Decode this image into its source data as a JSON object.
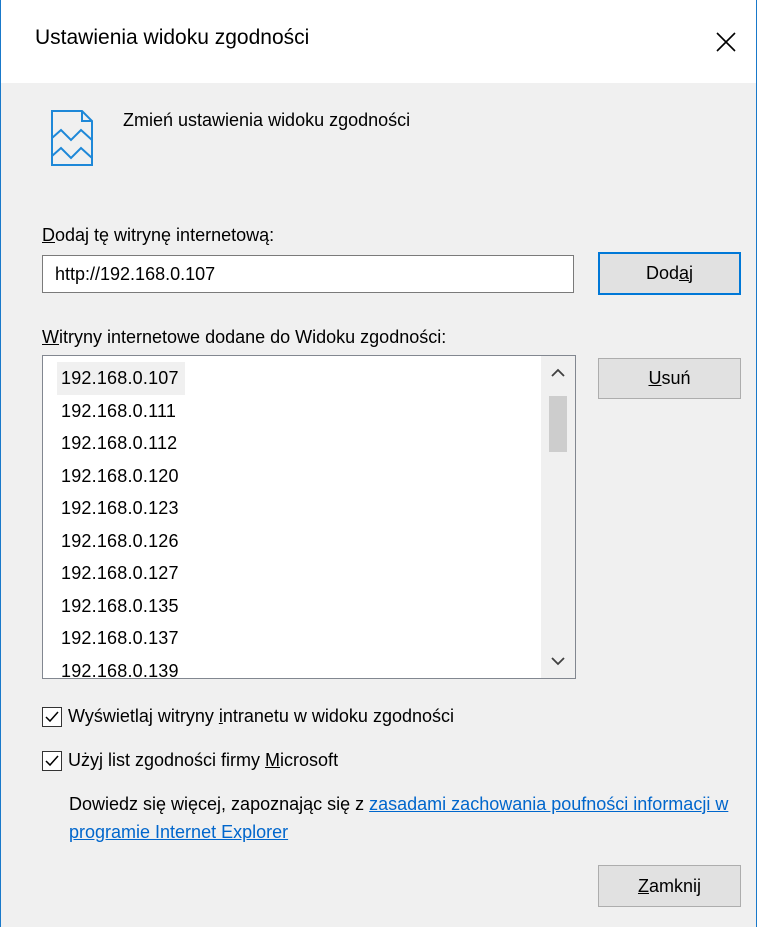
{
  "window": {
    "title": "Ustawienia widoku zgodności",
    "close_icon": "close-icon"
  },
  "header": {
    "icon": "compatibility-view-icon",
    "text": "Zmień ustawienia widoku zgodności"
  },
  "add_site": {
    "label_prefix": "",
    "label_hotkey": "D",
    "label_rest": "odaj tę witrynę internetową:",
    "input_value": "http://192.168.0.107",
    "add_button_pre": "Dod",
    "add_button_hotkey": "a",
    "add_button_post": "j"
  },
  "sites_list": {
    "label_hotkey": "W",
    "label_rest": "itryny internetowe dodane do Widoku zgodności:",
    "items": [
      "192.168.0.107",
      "192.168.0.111",
      "192.168.0.112",
      "192.168.0.120",
      "192.168.0.123",
      "192.168.0.126",
      "192.168.0.127",
      "192.168.0.135",
      "192.168.0.137",
      "192.168.0.139"
    ],
    "selected_index": 0,
    "remove_button_hotkey": "U",
    "remove_button_rest": "suń"
  },
  "options": {
    "intranet_pre": "Wyświetlaj witryny ",
    "intranet_hotkey": "i",
    "intranet_post": "ntranetu w widoku zgodności",
    "intranet_checked": true,
    "microsoft_pre": "Użyj list zgodności firmy ",
    "microsoft_hotkey": "M",
    "microsoft_post": "icrosoft",
    "microsoft_checked": true
  },
  "info": {
    "text": "Dowiedz się więcej, zapoznając się z ",
    "link_text": "zasadami zachowania poufności informacji w programie Internet Explorer"
  },
  "footer": {
    "close_button_hotkey": "Z",
    "close_button_rest": "amknij"
  },
  "colors": {
    "accent": "#0078d7",
    "link": "#0066cc",
    "dialog_bg": "#f0f0f0",
    "icon": "#1e88d8"
  }
}
